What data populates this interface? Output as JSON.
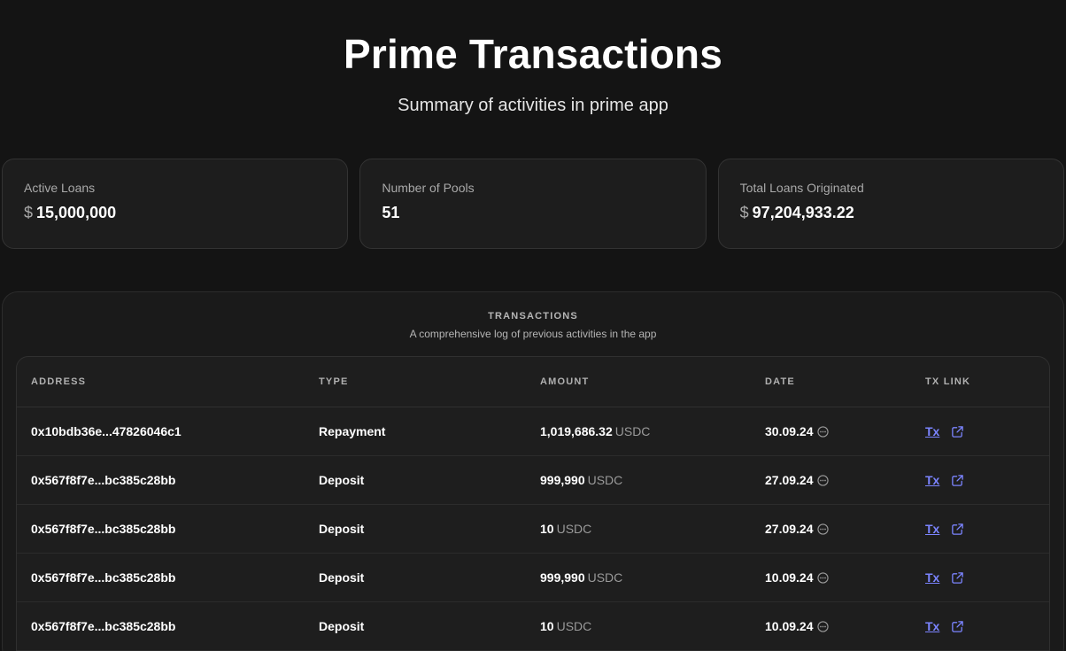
{
  "header": {
    "title": "Prime Transactions",
    "subtitle": "Summary of activities in prime app"
  },
  "stats": [
    {
      "label": "Active Loans",
      "currency": "$",
      "value": "15,000,000"
    },
    {
      "label": "Number of Pools",
      "currency": "",
      "value": "51"
    },
    {
      "label": "Total Loans Originated",
      "currency": "$",
      "value": "97,204,933.22"
    }
  ],
  "transactions": {
    "heading": "TRANSACTIONS",
    "caption": "A comprehensive log of previous activities in the app",
    "columns": {
      "address": "ADDRESS",
      "type": "TYPE",
      "amount": "AMOUNT",
      "date": "DATE",
      "tx_link": "TX LINK"
    },
    "rows": [
      {
        "address": "0x10bdb36e...47826046c1",
        "type": "Repayment",
        "amount": "1,019,686.32",
        "unit": "USDC",
        "date": "30.09.24",
        "link": "Tx"
      },
      {
        "address": "0x567f8f7e...bc385c28bb",
        "type": "Deposit",
        "amount": "999,990",
        "unit": "USDC",
        "date": "27.09.24",
        "link": "Tx"
      },
      {
        "address": "0x567f8f7e...bc385c28bb",
        "type": "Deposit",
        "amount": "10",
        "unit": "USDC",
        "date": "27.09.24",
        "link": "Tx"
      },
      {
        "address": "0x567f8f7e...bc385c28bb",
        "type": "Deposit",
        "amount": "999,990",
        "unit": "USDC",
        "date": "10.09.24",
        "link": "Tx"
      },
      {
        "address": "0x567f8f7e...bc385c28bb",
        "type": "Deposit",
        "amount": "10",
        "unit": "USDC",
        "date": "10.09.24",
        "link": "Tx"
      }
    ]
  },
  "colors": {
    "background": "#141414",
    "card": "#1d1d1d",
    "link": "#7b84ff",
    "muted": "#a9a9a9"
  },
  "icons": {
    "date_info": "clock-icon",
    "external_link": "external-link-icon"
  }
}
